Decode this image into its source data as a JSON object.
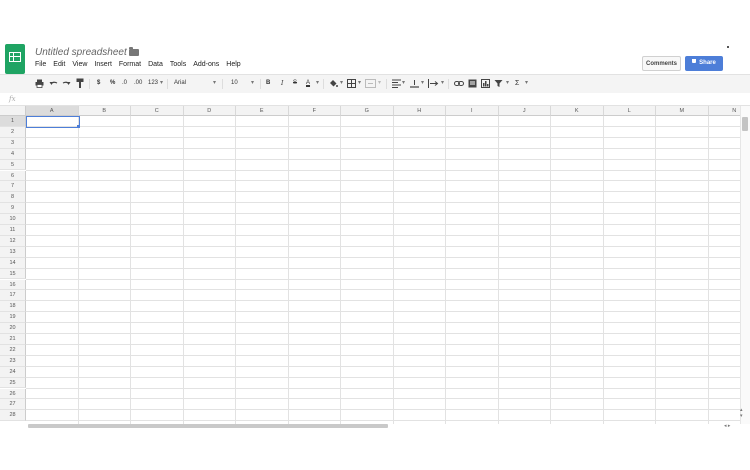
{
  "doc": {
    "title": "Untitled spreadsheet"
  },
  "menu": [
    "File",
    "Edit",
    "View",
    "Insert",
    "Format",
    "Data",
    "Tools",
    "Add-ons",
    "Help"
  ],
  "header": {
    "comments_label": "Comments",
    "share_label": "Share"
  },
  "toolbar": {
    "currency": "$",
    "percent": "%",
    "decrease_decimals": ".0",
    "increase_decimals": ".00",
    "more_formats": "123",
    "font": "Arial",
    "font_size": "10",
    "bold": "B",
    "italic": "I",
    "strikethrough": "S",
    "text_color": "A",
    "functions": "Σ"
  },
  "formula_bar": {
    "fx_label": "fx"
  },
  "columns": [
    "A",
    "B",
    "C",
    "D",
    "E",
    "F",
    "G",
    "H",
    "I",
    "J",
    "K",
    "L",
    "M",
    "N"
  ],
  "rows": [
    "1",
    "2",
    "3",
    "4",
    "5",
    "6",
    "7",
    "8",
    "9",
    "10",
    "11",
    "12",
    "13",
    "14",
    "15",
    "16",
    "17",
    "18",
    "19",
    "20",
    "21",
    "22",
    "23",
    "24",
    "25",
    "26",
    "27",
    "28"
  ],
  "selected_cell": "A1",
  "colors": {
    "accent": "#4d7ed8",
    "brand": "#1fa463",
    "share": "#4d7ed8"
  }
}
